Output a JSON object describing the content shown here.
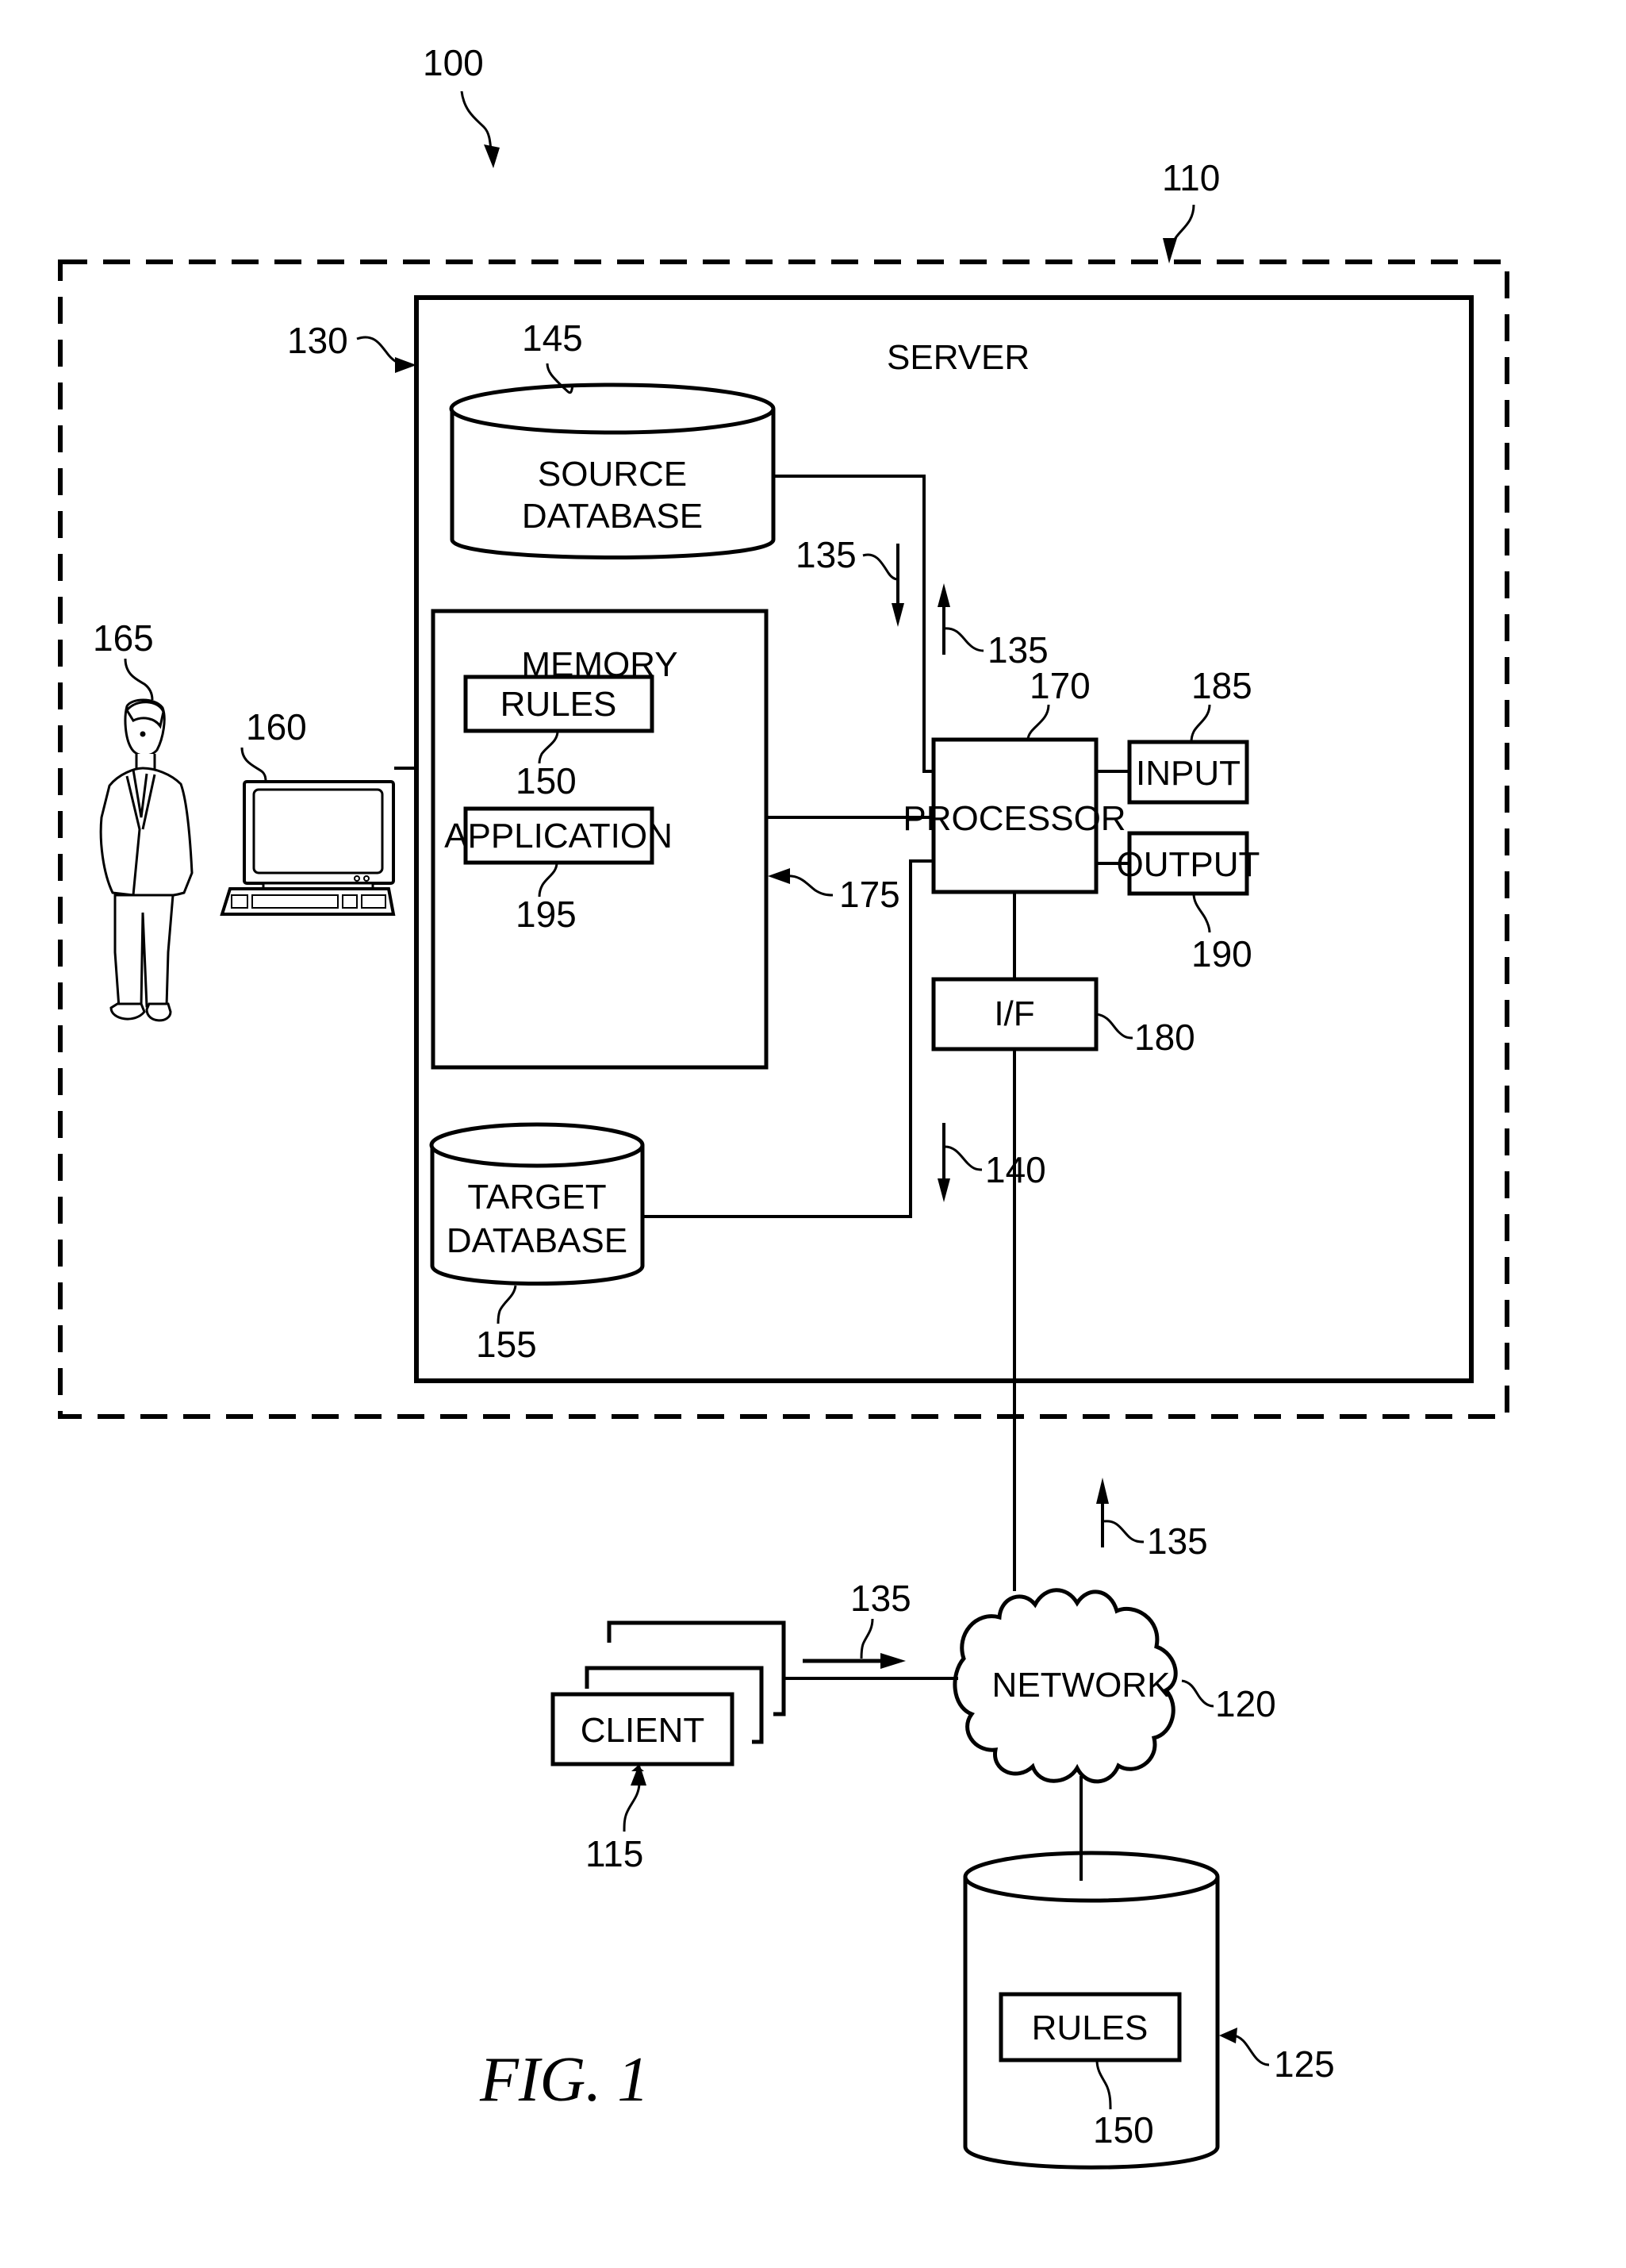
{
  "figure": {
    "caption": "FIG. 1",
    "system_ref": "100"
  },
  "environment": {
    "ref": "110"
  },
  "server": {
    "label": "SERVER",
    "ref": "130"
  },
  "source_database": {
    "line1": "SOURCE",
    "line2": "DATABASE",
    "ref": "145"
  },
  "memory": {
    "label": "MEMORY",
    "ref": "175",
    "rules": {
      "label": "RULES",
      "ref": "150"
    },
    "application": {
      "label": "APPLICATION",
      "ref": "195"
    }
  },
  "target_database": {
    "line1": "TARGET",
    "line2": "DATABASE",
    "ref": "155"
  },
  "processor": {
    "label": "PROCESSOR",
    "ref": "170"
  },
  "input": {
    "label": "INPUT",
    "ref": "185"
  },
  "output": {
    "label": "OUTPUT",
    "ref": "190"
  },
  "interface": {
    "label": "I/F",
    "ref": "180"
  },
  "user": {
    "ref": "165"
  },
  "workstation": {
    "ref": "160"
  },
  "flows": {
    "source_down_ref": "135",
    "source_up_ref": "135",
    "target_down_ref": "140",
    "network_up_ref": "135",
    "client_to_network_ref": "135"
  },
  "network": {
    "label": "NETWORK",
    "ref": "120"
  },
  "client": {
    "label": "CLIENT",
    "ref": "115"
  },
  "rules_repository": {
    "ref": "125",
    "rules": {
      "label": "RULES",
      "ref": "150"
    }
  }
}
